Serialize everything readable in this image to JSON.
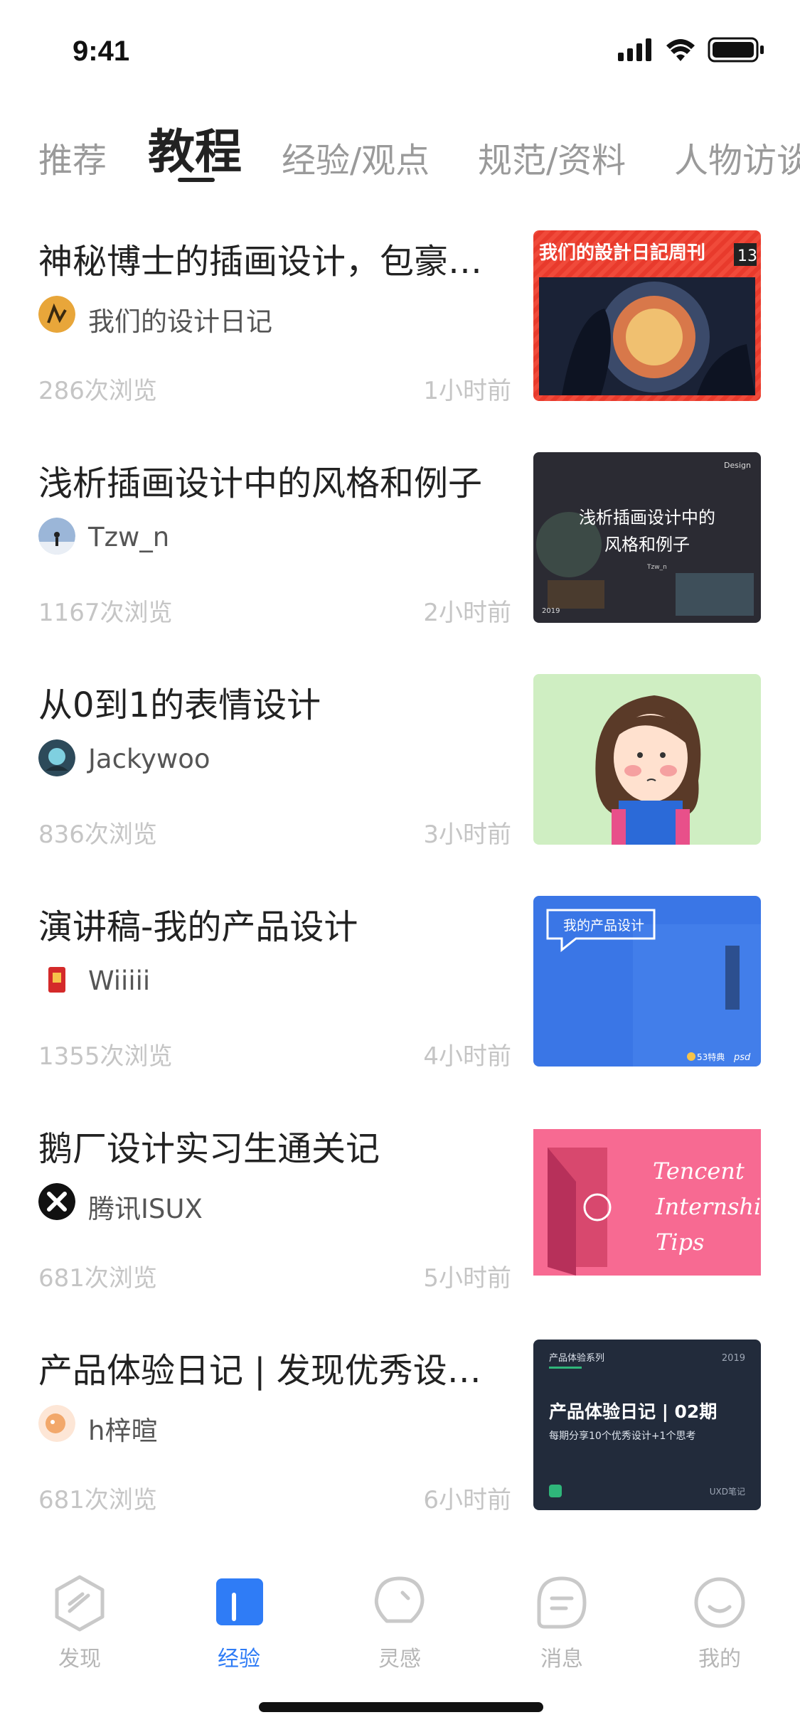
{
  "status_bar": {
    "time": "9:41"
  },
  "tabs": [
    {
      "label": "推荐",
      "active": false
    },
    {
      "label": "教程",
      "active": true
    },
    {
      "label": "经验/观点",
      "active": false
    },
    {
      "label": "规范/资料",
      "active": false
    },
    {
      "label": "人物访谈",
      "active": false
    }
  ],
  "articles": [
    {
      "title": "神秘博士的插画设计，包豪斯的主题插画",
      "author": "我们的设计日记",
      "views": "286次浏览",
      "time": "1小时前",
      "thumb_text": [
        "我们的設計日記周刊",
        "13"
      ]
    },
    {
      "title": "浅析插画设计中的风格和例子",
      "author": "Tzw_n",
      "views": "1167次浏览",
      "time": "2小时前",
      "thumb_text": [
        "浅析插画设计中的",
        "风格和例子",
        "Design",
        "2019",
        "Tzw_n"
      ]
    },
    {
      "title": "从0到1的表情设计",
      "author": "Jackywoo",
      "views": "836次浏览",
      "time": "3小时前",
      "thumb_text": []
    },
    {
      "title": "演讲稿-我的产品设计",
      "author": "Wiiiii",
      "views": "1355次浏览",
      "time": "4小时前",
      "thumb_text": [
        "我的产品设计",
        "53特典",
        "psd"
      ]
    },
    {
      "title": "鹅厂设计实习生通关记",
      "author": "腾讯ISUX",
      "views": "681次浏览",
      "time": "5小时前",
      "thumb_text": [
        "Tencent",
        "Internship",
        "Tips"
      ]
    },
    {
      "title": "产品体验日记 | 发现优秀设计…",
      "author": "h梓暄",
      "views": "681次浏览",
      "time": "6小时前",
      "thumb_text": [
        "产品体验系列",
        "2019",
        "产品体验日记 | 02期",
        "每期分享10个优秀设计+1个思考",
        "UXD笔记"
      ]
    }
  ],
  "bottom_nav": [
    {
      "label": "发现",
      "icon": "compass-icon",
      "active": false
    },
    {
      "label": "经验",
      "icon": "book-icon",
      "active": true
    },
    {
      "label": "灵感",
      "icon": "lightbulb-icon",
      "active": false
    },
    {
      "label": "消息",
      "icon": "message-icon",
      "active": false
    },
    {
      "label": "我的",
      "icon": "smile-icon",
      "active": false
    }
  ],
  "colors": {
    "accent": "#2f7cf6",
    "muted": "#c5c5c5"
  }
}
